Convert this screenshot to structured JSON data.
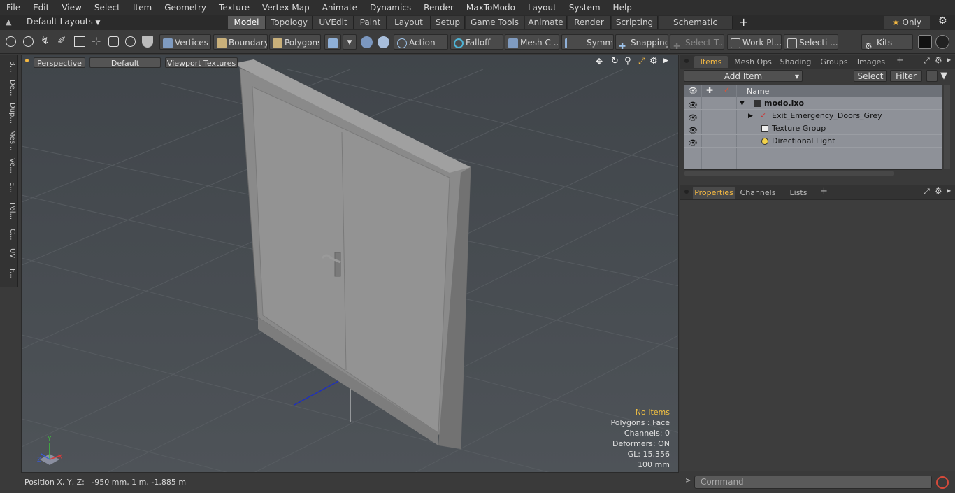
{
  "menu": [
    "File",
    "Edit",
    "View",
    "Select",
    "Item",
    "Geometry",
    "Texture",
    "Vertex Map",
    "Animate",
    "Dynamics",
    "Render",
    "MaxToModo",
    "Layout",
    "System",
    "Help"
  ],
  "layouts_label": "Default Layouts",
  "layout_tabs": [
    "Model",
    "Topology",
    "UVEdit",
    "Paint",
    "Layout",
    "Setup",
    "Game Tools",
    "Animate",
    "Render",
    "Scripting",
    "Schematic Fusion"
  ],
  "active_tab": "Model",
  "only_label": "Only",
  "toolbar": {
    "vertices": "Vertices",
    "boundary": "Boundary",
    "polygons": "Polygons",
    "action": "Action",
    "falloff": "Falloff",
    "mesh": "Mesh C ...",
    "symm": "Symm ...",
    "snapping": "Snapping",
    "select_t": "Select T...",
    "work_pl": "Work Pl...",
    "selecti": "Selecti ...",
    "kits": "Kits"
  },
  "left_tabs": [
    "B...",
    "De...",
    "Dup...",
    "Mes...",
    "Ve...",
    "E...",
    "Pol...",
    "C...",
    "UV",
    "F..."
  ],
  "viewport": {
    "perspective": "Perspective",
    "shading": "Default",
    "textures": "Viewport Textures",
    "stats": {
      "no_items": "No Items",
      "polygons": "Polygons : Face",
      "channels": "Channels: 0",
      "deformers": "Deformers: ON",
      "gl": "GL: 15,356",
      "scale": "100 mm"
    },
    "axis_x": "X",
    "axis_y": "Y",
    "axis_z": "Z"
  },
  "status": {
    "position": "Position X, Y, Z:   -950 mm, 1 m, -1.885 m"
  },
  "items_panel": {
    "tabs": [
      "Items",
      "Mesh Ops",
      "Shading",
      "Groups",
      "Images"
    ],
    "add_item": "Add Item",
    "select": "Select",
    "filter": "Filter",
    "name_header": "Name",
    "rows": [
      {
        "label": "modo.lxo",
        "indent": 0
      },
      {
        "label": "Exit_Emergency_Doors_Grey",
        "indent": 1
      },
      {
        "label": "Texture Group",
        "indent": 1
      },
      {
        "label": "Directional Light",
        "indent": 1
      }
    ]
  },
  "properties_panel": {
    "tabs": [
      "Properties",
      "Channels",
      "Lists"
    ]
  },
  "command": {
    "placeholder": "Command"
  },
  "colors": {
    "accent": "#f5b942",
    "viewport_bg": "#474c51",
    "list_bg": "#8e9198"
  }
}
